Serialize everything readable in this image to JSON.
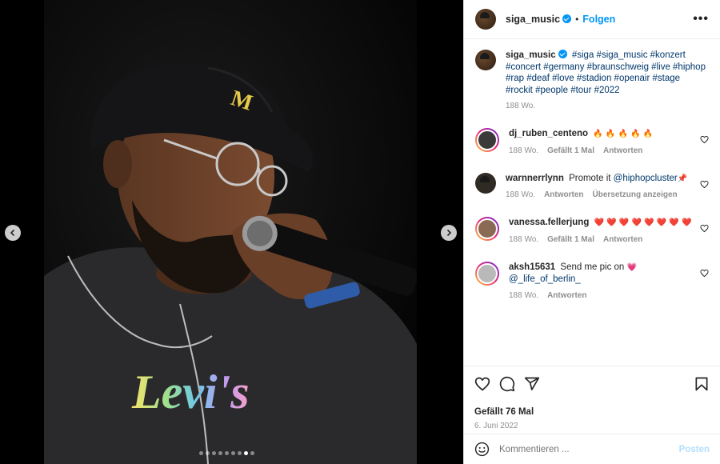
{
  "header": {
    "username": "siga_music",
    "separator": "•",
    "follow_label": "Folgen",
    "more_label": "•••"
  },
  "media": {
    "logo_text": "Levi's",
    "dots_total": 9,
    "active_dot_index": 7
  },
  "caption": {
    "username": "siga_music",
    "hashtags": "#siga #siga_music #konzert #concert #germany #braunschweig #live #hiphop #rap #deaf #love #stadion #openair #stage #rockit #people #tour #2022",
    "time": "188 Wo."
  },
  "comments": [
    {
      "username": "dj_ruben_centeno",
      "text": "🔥 🔥 🔥 🔥 🔥",
      "time": "188 Wo.",
      "likes": "Gefällt 1 Mal",
      "reply": "Antworten"
    },
    {
      "username": "warnnerrlynn",
      "text_before": "Promote it ",
      "mention": "@hiphopcluster",
      "text_after": "📌",
      "time": "188 Wo.",
      "reply": "Antworten",
      "translate": "Übersetzung anzeigen"
    },
    {
      "username": "vanessa.fellerjung",
      "text": "❤️ ❤️ ❤️ ❤️ ❤️ ❤️ ❤️ ❤️",
      "time": "188 Wo.",
      "likes": "Gefällt 1 Mal",
      "reply": "Antworten"
    },
    {
      "username": "aksh15631",
      "text_before": "Send me pic on ",
      "heart": "💗",
      "mention": " @_life_of_berlin_",
      "time": "188 Wo.",
      "reply": "Antworten"
    }
  ],
  "post": {
    "likes": "Gefällt 76 Mal",
    "date": "6. Juni 2022"
  },
  "add_comment": {
    "placeholder": "Kommentieren ...",
    "post_label": "Posten"
  },
  "colors": {
    "accent": "#0095f6",
    "link": "#00376b",
    "muted": "#8e8e8e"
  }
}
